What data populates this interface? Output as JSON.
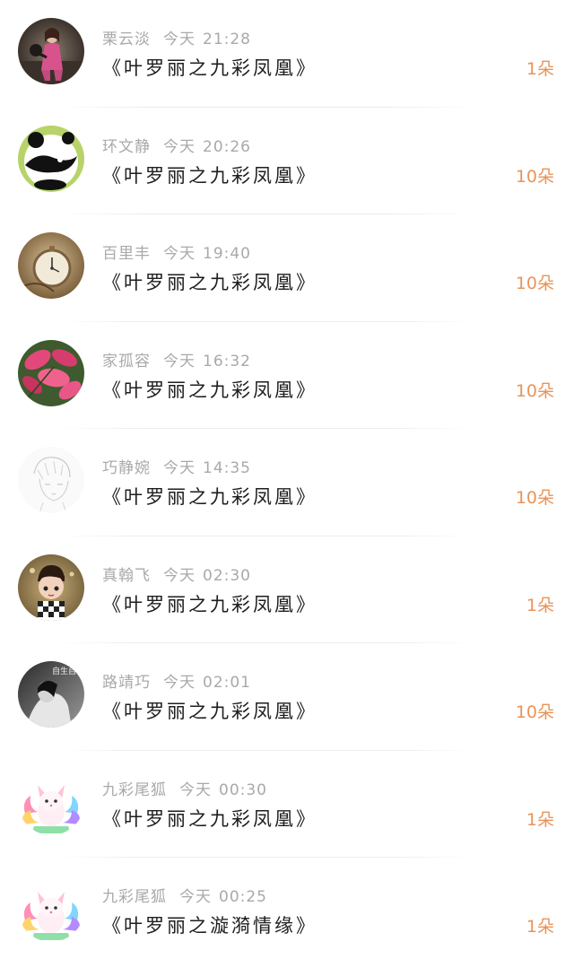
{
  "items": [
    {
      "name": "栗云淡",
      "day": "今天",
      "time": "21:28",
      "title": "《叶罗丽之九彩凤凰》",
      "count": "1朵",
      "avatar": "girl-portrait-avatar"
    },
    {
      "name": "环文静",
      "day": "今天",
      "time": "20:26",
      "title": "《叶罗丽之九彩凤凰》",
      "count": "10朵",
      "avatar": "panda-avatar"
    },
    {
      "name": "百里丰",
      "day": "今天",
      "time": "19:40",
      "title": "《叶罗丽之九彩凤凰》",
      "count": "10朵",
      "avatar": "pocket-watch-avatar"
    },
    {
      "name": "家孤容",
      "day": "今天",
      "time": "16:32",
      "title": "《叶罗丽之九彩凤凰》",
      "count": "10朵",
      "avatar": "pink-leaves-avatar"
    },
    {
      "name": "巧静婉",
      "day": "今天",
      "time": "14:35",
      "title": "《叶罗丽之九彩凤凰》",
      "count": "10朵",
      "avatar": "sketch-boy-avatar"
    },
    {
      "name": "真翰飞",
      "day": "今天",
      "time": "02:30",
      "title": "《叶罗丽之九彩凤凰》",
      "count": "1朵",
      "avatar": "cartoon-boy-avatar"
    },
    {
      "name": "路靖巧",
      "day": "今天",
      "time": "02:01",
      "title": "《叶罗丽之九彩凤凰》",
      "count": "10朵",
      "avatar": "bw-photo-avatar"
    },
    {
      "name": "九彩尾狐",
      "day": "今天",
      "time": "00:30",
      "title": "《叶罗丽之九彩凤凰》",
      "count": "1朵",
      "avatar": "rainbow-fox-avatar"
    },
    {
      "name": "九彩尾狐",
      "day": "今天",
      "time": "00:25",
      "title": "《叶罗丽之漩漪情缘》",
      "count": "1朵",
      "avatar": "rainbow-fox-avatar"
    }
  ],
  "avatar_text": {
    "bw_photo_caption": "自生自"
  },
  "colors": {
    "meta": "#a9a9a9",
    "title": "#1e1e1e",
    "count": "#e8945a",
    "divider": "#ececec"
  }
}
